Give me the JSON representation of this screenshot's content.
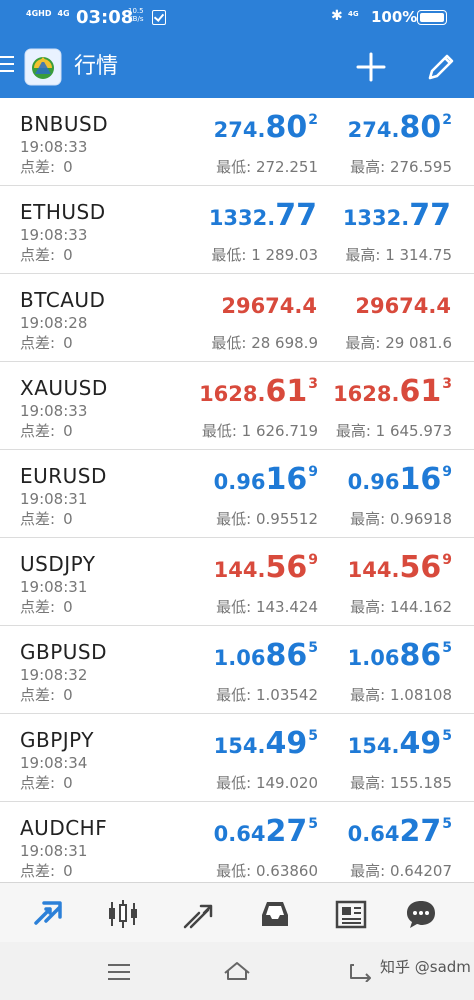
{
  "status_bar": {
    "net1": "4GHD",
    "net2": "4G",
    "time": "03:08",
    "speed_value": "10.5",
    "speed_unit": "KB/s",
    "signal": "4G",
    "battery": "100%"
  },
  "app_bar": {
    "title": "行情"
  },
  "labels": {
    "spread": "点差:"
  },
  "quotes": [
    {
      "symbol": "BNBUSD",
      "time": "19:08:33",
      "spread": "0",
      "color": "blue",
      "bid": {
        "lead": "274.",
        "big": "80",
        "sup": "2"
      },
      "ask": {
        "lead": "274.",
        "big": "80",
        "sup": "2"
      },
      "low": "最低: 272.251",
      "high": "最高: 276.595"
    },
    {
      "symbol": "ETHUSD",
      "time": "19:08:33",
      "spread": "0",
      "color": "blue",
      "bid": {
        "lead": "1332.",
        "big": "77",
        "sup": ""
      },
      "ask": {
        "lead": "1332.",
        "big": "77",
        "sup": ""
      },
      "low": "最低: 1 289.03",
      "high": "最高: 1 314.75"
    },
    {
      "symbol": "BTCAUD",
      "time": "19:08:28",
      "spread": "0",
      "color": "red",
      "bid": {
        "lead": "29674.4",
        "big": "",
        "sup": ""
      },
      "ask": {
        "lead": "29674.4",
        "big": "",
        "sup": ""
      },
      "low": "最低: 28 698.9",
      "high": "最高: 29 081.6"
    },
    {
      "symbol": "XAUUSD",
      "time": "19:08:33",
      "spread": "0",
      "color": "red",
      "bid": {
        "lead": "1628.",
        "big": "61",
        "sup": "3"
      },
      "ask": {
        "lead": "1628.",
        "big": "61",
        "sup": "3"
      },
      "low": "最低: 1 626.719",
      "high": "最高: 1 645.973"
    },
    {
      "symbol": "EURUSD",
      "time": "19:08:31",
      "spread": "0",
      "color": "blue",
      "bid": {
        "lead": "0.96",
        "big": "16",
        "sup": "9"
      },
      "ask": {
        "lead": "0.96",
        "big": "16",
        "sup": "9"
      },
      "low": "最低: 0.95512",
      "high": "最高: 0.96918"
    },
    {
      "symbol": "USDJPY",
      "time": "19:08:31",
      "spread": "0",
      "color": "red",
      "bid": {
        "lead": "144.",
        "big": "56",
        "sup": "9"
      },
      "ask": {
        "lead": "144.",
        "big": "56",
        "sup": "9"
      },
      "low": "最低: 143.424",
      "high": "最高: 144.162"
    },
    {
      "symbol": "GBPUSD",
      "time": "19:08:32",
      "spread": "0",
      "color": "blue",
      "bid": {
        "lead": "1.06",
        "big": "86",
        "sup": "5"
      },
      "ask": {
        "lead": "1.06",
        "big": "86",
        "sup": "5"
      },
      "low": "最低: 1.03542",
      "high": "最高: 1.08108"
    },
    {
      "symbol": "GBPJPY",
      "time": "19:08:34",
      "spread": "0",
      "color": "blue",
      "bid": {
        "lead": "154.",
        "big": "49",
        "sup": "5"
      },
      "ask": {
        "lead": "154.",
        "big": "49",
        "sup": "5"
      },
      "low": "最低: 149.020",
      "high": "最高: 155.185"
    },
    {
      "symbol": "AUDCHF",
      "time": "19:08:31",
      "spread": "0",
      "color": "blue",
      "bid": {
        "lead": "0.64",
        "big": "27",
        "sup": "5"
      },
      "ask": {
        "lead": "0.64",
        "big": "27",
        "sup": "5"
      },
      "low": "最低: 0.63860",
      "high": "最高: 0.64207"
    }
  ],
  "tabs": [
    {
      "icon": "quotes-arrows-icon",
      "active": true
    },
    {
      "icon": "candlestick-chart-icon",
      "active": false
    },
    {
      "icon": "trade-trend-icon",
      "active": false
    },
    {
      "icon": "history-inbox-icon",
      "active": false
    },
    {
      "icon": "news-icon",
      "active": false
    },
    {
      "icon": "chat-icon",
      "active": false
    }
  ],
  "watermark": "知乎 @sadm",
  "colors": {
    "brand": "#2c80d8",
    "price_up": "#1f7ad6",
    "price_down": "#d84a3c",
    "active_tab": "#2c80d8",
    "inactive_tab": "#4a4a4a"
  }
}
